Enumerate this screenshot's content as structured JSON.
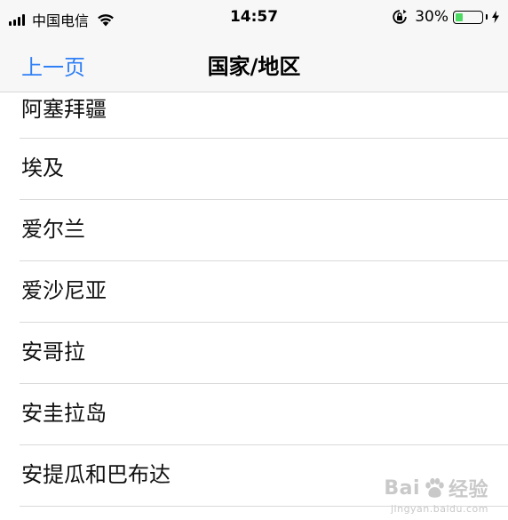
{
  "status_bar": {
    "carrier": "中国电信",
    "time": "14:57",
    "battery_percent": "30%",
    "battery_color": "#4cd964",
    "battery_level": 0.3,
    "icons": [
      "signal-icon",
      "wifi-icon",
      "rotation-lock-icon",
      "battery-icon",
      "charging-bolt-icon"
    ]
  },
  "nav_bar": {
    "back_label": "上一页",
    "title": "国家/地区",
    "accent_color": "#2f7ff6"
  },
  "list": {
    "items": [
      {
        "label": "阿塞拜疆"
      },
      {
        "label": "埃及"
      },
      {
        "label": "爱尔兰"
      },
      {
        "label": "爱沙尼亚"
      },
      {
        "label": "安哥拉"
      },
      {
        "label": "安圭拉岛"
      },
      {
        "label": "安提瓜和巴布达"
      }
    ]
  },
  "watermark": {
    "brand_left": "Bai",
    "brand_right": "经验",
    "subtitle": "jingyan.baidu.com",
    "icon": "baidu-paw-icon"
  }
}
